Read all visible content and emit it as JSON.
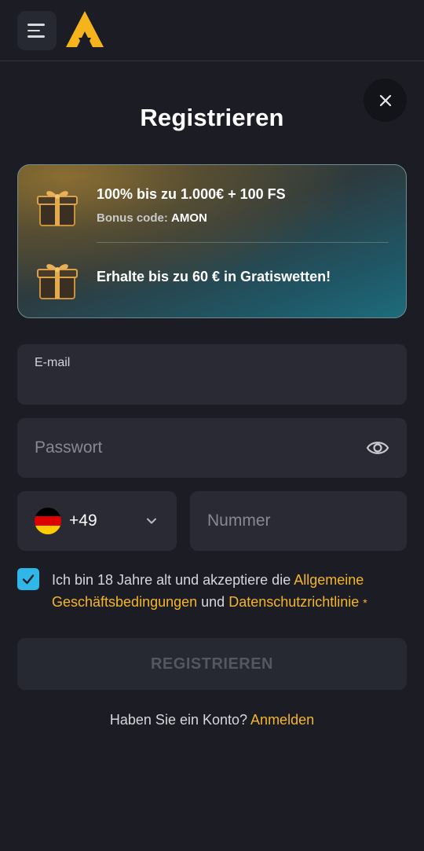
{
  "header": {
    "menu_icon": "hamburger-menu-icon",
    "logo_icon": "brand-logo-a-icon",
    "close_icon": "close-icon"
  },
  "page": {
    "title": "Registrieren"
  },
  "bonus": {
    "items": [
      {
        "title": "100% bis zu 1.000€ + 100 FS",
        "sub_label": "Bonus code:",
        "sub_value": "AMON",
        "icon": "gift-box-icon"
      },
      {
        "title": "Erhalte bis zu 60 € in Gratiswetten!",
        "icon": "gift-box-icon"
      }
    ]
  },
  "form": {
    "email_label": "E-mail",
    "password_placeholder": "Passwort",
    "password_icon": "eye-icon",
    "country_code": "+49",
    "country_flag": "germany-flag-icon",
    "number_placeholder": "Nummer",
    "terms": {
      "checked": true,
      "text_before": "Ich bin 18 Jahre alt und akzeptiere die ",
      "link1": "Allgemeine Geschäftsbedingungen",
      "text_mid": " und ",
      "link2": "Datenschutzrichtlinie",
      "required_mark": "*"
    },
    "submit_label": "REGISTRIEREN"
  },
  "footer": {
    "question": "Haben Sie ein Konto?",
    "login_link": "Anmelden"
  },
  "colors": {
    "background": "#1c1d24",
    "field": "#292a34",
    "accent": "#f5b52a",
    "checkbox": "#2fb7e8"
  }
}
